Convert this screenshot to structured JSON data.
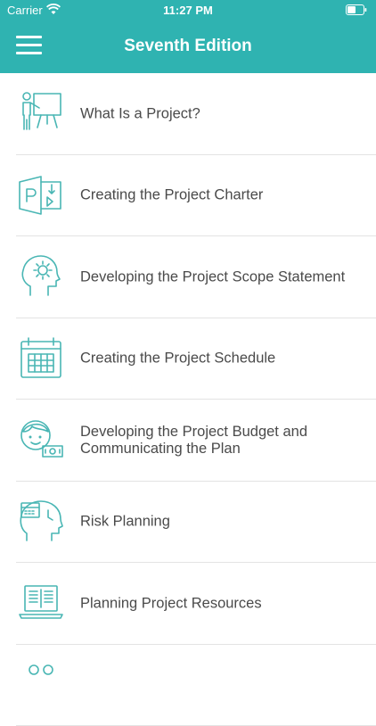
{
  "status_bar": {
    "carrier": "Carrier",
    "time": "11:27 PM"
  },
  "header": {
    "title": "Seventh Edition",
    "menu_icon": "hamburger-menu-icon"
  },
  "colors": {
    "accent": "#2fb3b1",
    "icon": "#49b6b4",
    "text": "#4a4a4a",
    "divider": "#e3e3e3"
  },
  "chapters": [
    {
      "label": "What Is a Project?",
      "icon": "presentation-icon"
    },
    {
      "label": "Creating the Project Charter",
      "icon": "project-file-icon"
    },
    {
      "label": "Developing the Project Scope Statement",
      "icon": "head-gear-icon"
    },
    {
      "label": "Creating the Project Schedule",
      "icon": "calendar-icon"
    },
    {
      "label": "Developing the Project Budget and Communicating the Plan",
      "icon": "person-money-icon"
    },
    {
      "label": "Risk Planning",
      "icon": "head-calendar-icon"
    },
    {
      "label": "Planning Project Resources",
      "icon": "laptop-icon"
    }
  ]
}
